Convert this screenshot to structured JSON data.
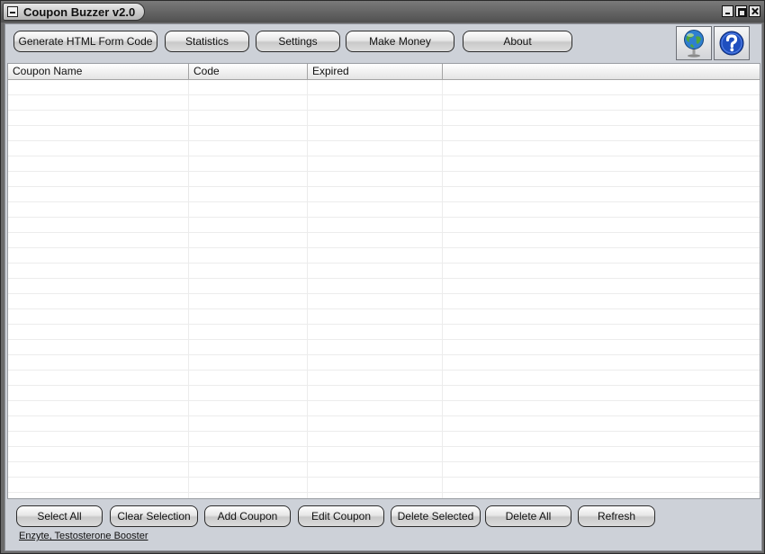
{
  "window": {
    "title": "Coupon Buzzer v2.0"
  },
  "toolbar": {
    "generate_html_label": "Generate HTML Form Code",
    "statistics_label": "Statistics",
    "settings_label": "Settings",
    "make_money_label": "Make Money",
    "about_label": "About",
    "globe_icon": "globe-icon",
    "help_icon": "help-icon"
  },
  "table": {
    "columns": [
      "Coupon Name",
      "Code",
      "Expired",
      ""
    ],
    "rows": []
  },
  "actions": {
    "select_all_label": "Select All",
    "clear_selection_label": "Clear Selection",
    "add_coupon_label": "Add Coupon",
    "edit_coupon_label": "Edit Coupon",
    "delete_selected_label": "Delete Selected",
    "delete_all_label": "Delete All",
    "refresh_label": "Refresh"
  },
  "status": {
    "link_text": "Enzyte, Testosterone Booster"
  },
  "colors": {
    "panel": "#cdd1d8",
    "titlebar": "#606060",
    "help_blue": "#1f4fbf"
  }
}
